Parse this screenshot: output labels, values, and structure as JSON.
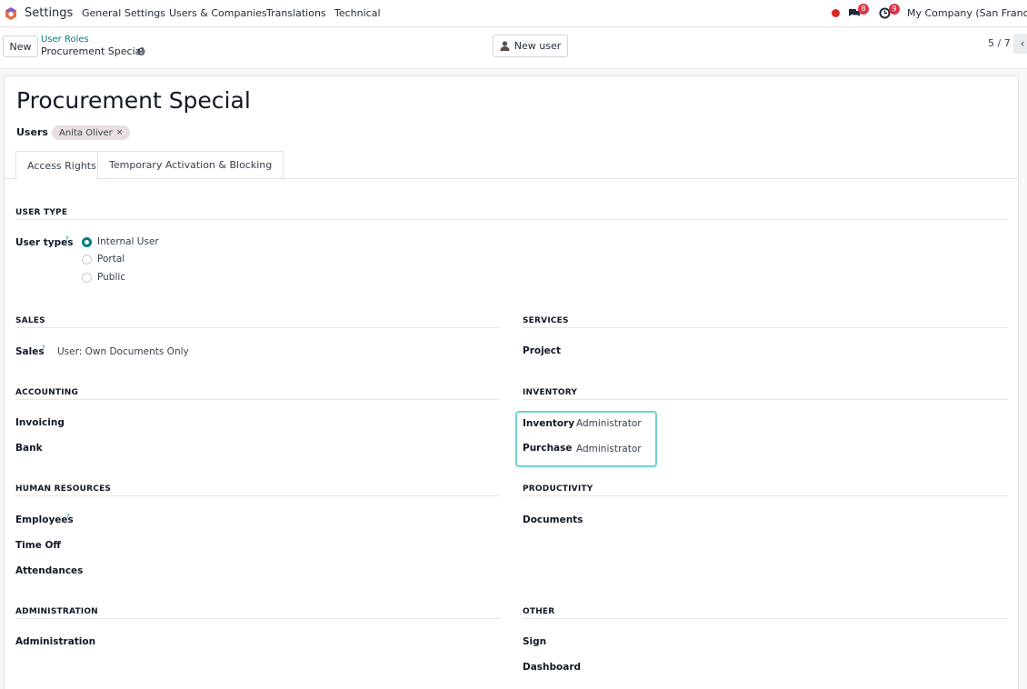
{
  "topnav": {
    "app_name": "Settings",
    "menu": [
      "General Settings",
      "Users & Companies",
      "Translations",
      "Technical"
    ],
    "chat_count": "8",
    "activity_count": "9",
    "company": "My Company (San Francisco)"
  },
  "control": {
    "new_label": "New",
    "breadcrumb_parent": "User Roles",
    "breadcrumb_current": "Procurement Special",
    "new_user_label": "New user",
    "pager": "5 / 7"
  },
  "form": {
    "title": "Procurement Special",
    "users_label": "Users",
    "user_tag": "Anita Oliver",
    "tabs": [
      "Access Rights",
      "Temporary Activation & Blocking"
    ],
    "user_type": {
      "section": "USER TYPE",
      "label": "User types",
      "options": [
        "Internal User",
        "Portal",
        "Public"
      ],
      "selected": "Internal User"
    },
    "sections": {
      "sales": {
        "title": "SALES",
        "fields": [
          {
            "label": "Sales",
            "value": "User: Own Documents Only"
          }
        ]
      },
      "services": {
        "title": "SERVICES",
        "fields": [
          {
            "label": "Project",
            "value": ""
          }
        ]
      },
      "accounting": {
        "title": "ACCOUNTING",
        "fields": [
          {
            "label": "Invoicing",
            "value": ""
          },
          {
            "label": "Bank",
            "value": ""
          }
        ]
      },
      "inventory": {
        "title": "INVENTORY",
        "fields": [
          {
            "label": "Inventory",
            "value": "Administrator"
          },
          {
            "label": "Purchase",
            "value": "Administrator"
          }
        ]
      },
      "hr": {
        "title": "HUMAN RESOURCES",
        "fields": [
          {
            "label": "Employees",
            "value": ""
          },
          {
            "label": "Time Off",
            "value": ""
          },
          {
            "label": "Attendances",
            "value": ""
          }
        ]
      },
      "productivity": {
        "title": "PRODUCTIVITY",
        "fields": [
          {
            "label": "Documents",
            "value": ""
          }
        ]
      },
      "administration": {
        "title": "ADMINISTRATION",
        "fields": [
          {
            "label": "Administration",
            "value": ""
          }
        ]
      },
      "other": {
        "title": "OTHER",
        "fields": [
          {
            "label": "Sign",
            "value": ""
          },
          {
            "label": "Dashboard",
            "value": ""
          }
        ]
      }
    },
    "help_mark": "?"
  },
  "colors": {
    "accent": "#017e84",
    "highlight": "#6fd3cf",
    "badge": "#dc3545"
  }
}
